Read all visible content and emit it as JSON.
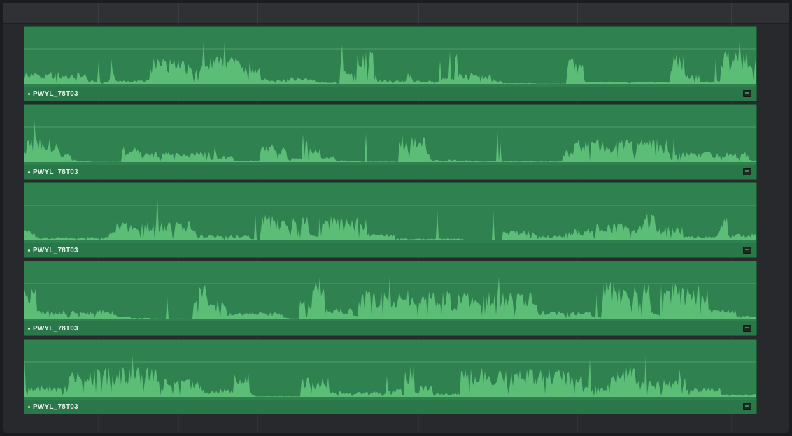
{
  "timeline": {
    "clips": [
      {
        "name": "PWYL_78T03",
        "seed": 11,
        "energy": 0.95
      },
      {
        "name": "PWYL_78T03",
        "seed": 23,
        "energy": 0.55
      },
      {
        "name": "PWYL_78T03",
        "seed": 37,
        "energy": 0.5
      },
      {
        "name": "PWYL_78T03",
        "seed": 53,
        "energy": 0.8
      },
      {
        "name": "PWYL_78T03",
        "seed": 71,
        "energy": 0.7
      }
    ]
  },
  "colors": {
    "clip_fill": "#2f8150",
    "wave_fill": "#5cbd76",
    "level_line": "#6fb787"
  }
}
